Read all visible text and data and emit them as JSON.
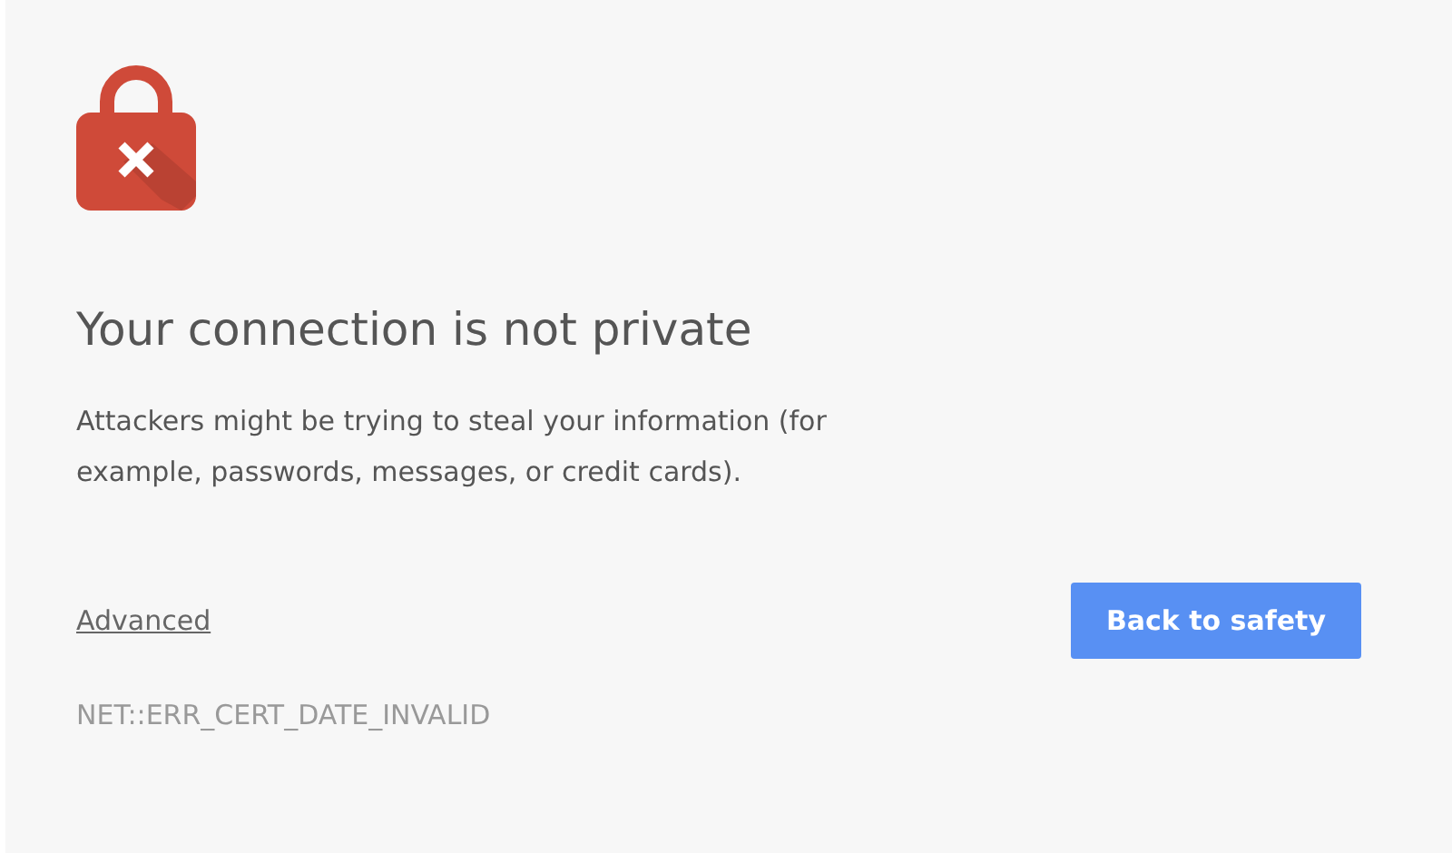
{
  "heading": "Your connection is not private",
  "message": "Attackers might be trying to steal your information (for example, passwords, messages, or credit cards).",
  "advanced_link": "Advanced",
  "primary_button": "Back to safety",
  "error_code": "NET::ERR_CERT_DATE_INVALID"
}
